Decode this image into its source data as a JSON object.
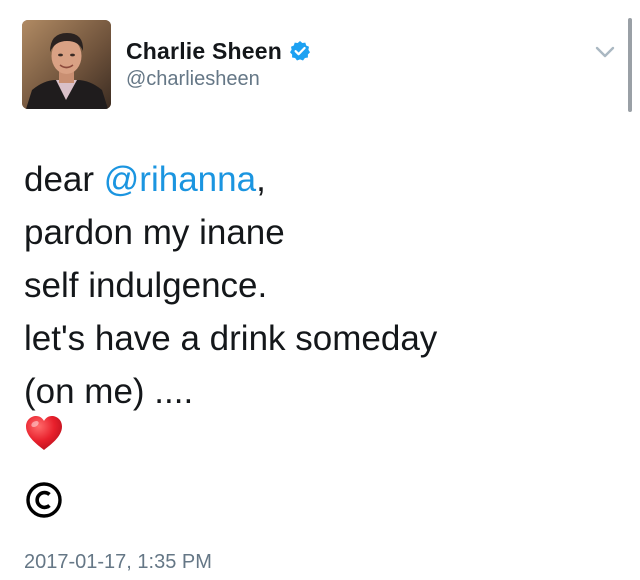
{
  "tweet": {
    "author": {
      "display_name": "Charlie Sheen",
      "handle": "@charliesheen",
      "verified": true,
      "avatar_icon": "profile-photo"
    },
    "menu_icon": "chevron-down-icon",
    "text": {
      "line1_prefix": "dear ",
      "line1_mention": "@rihanna",
      "line1_suffix": ",",
      "line2": "pardon my inane",
      "line3": "self indulgence.",
      "line4": "let's have a drink someday",
      "line5": "(on me) ....",
      "emojis": [
        "red-heart",
        "copyright-sign"
      ]
    },
    "timestamp": "2017-01-17, 1:35 PM"
  },
  "colors": {
    "text": "#14171a",
    "secondary": "#657786",
    "link": "#1b95e0",
    "verified_badge": "#1da1f2",
    "heart": "#e0245e"
  }
}
